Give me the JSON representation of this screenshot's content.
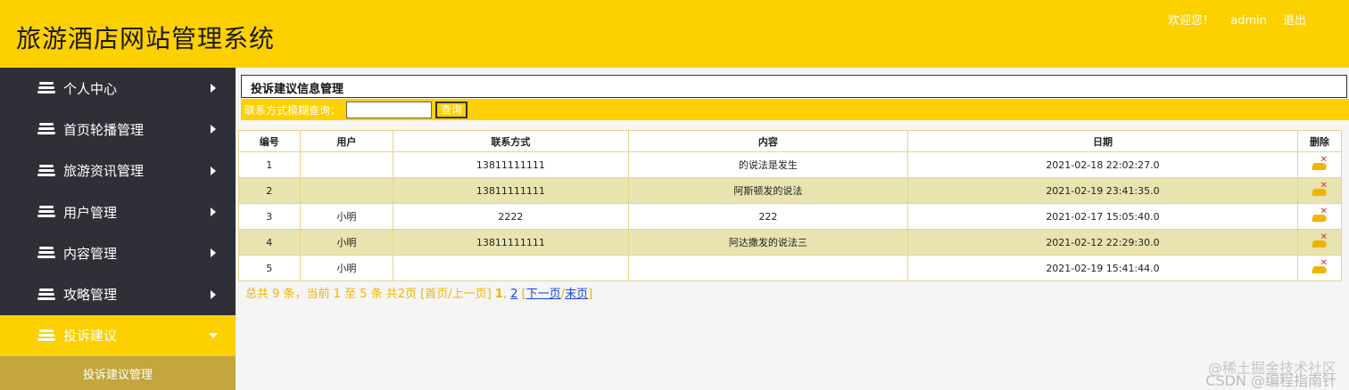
{
  "app": {
    "title": "旅游酒店网站管理系统"
  },
  "top_links": {
    "welcome": "欢迎您！",
    "user": "admin",
    "logout": "退出"
  },
  "sidebar": {
    "items": [
      {
        "label": "个人中心"
      },
      {
        "label": "首页轮播管理"
      },
      {
        "label": "旅游资讯管理"
      },
      {
        "label": "用户管理"
      },
      {
        "label": "内容管理"
      },
      {
        "label": "攻略管理"
      },
      {
        "label": "投诉建议"
      }
    ],
    "sub_item": "投诉建议管理"
  },
  "main": {
    "section_title": "投诉建议信息管理",
    "search_label": "联系方式模糊查询：",
    "search_value": "",
    "search_button": "查询",
    "columns": [
      "编号",
      "用户",
      "联系方式",
      "内容",
      "日期",
      "删除"
    ],
    "rows": [
      {
        "id": "1",
        "user": "",
        "contact": "13811111111",
        "content": "的说法是发生",
        "date": "2021-02-18 22:02:27.0"
      },
      {
        "id": "2",
        "user": "",
        "contact": "13811111111",
        "content": "阿斯顿发的说法",
        "date": "2021-02-19 23:41:35.0"
      },
      {
        "id": "3",
        "user": "小明",
        "contact": "2222",
        "content": "222",
        "date": "2021-02-17 15:05:40.0"
      },
      {
        "id": "4",
        "user": "小明",
        "contact": "13811111111",
        "content": "阿达撒发的说法三",
        "date": "2021-02-12 22:29:30.0"
      },
      {
        "id": "5",
        "user": "小明",
        "contact": "",
        "content": "",
        "date": "2021-02-19 15:41:44.0"
      }
    ],
    "pager": {
      "summary": "总共 9 条，当前 1 至 5 条 共2页",
      "first_prev": "[首页/上一页]",
      "page1": "1",
      "comma": ",",
      "page2": "2",
      "bracket_open": "[",
      "next": "下一页",
      "slash": "/",
      "last": "末页",
      "bracket_close": "]"
    }
  },
  "watermark": {
    "line1": "@稀土掘金技术社区",
    "line2": "CSDN @编程指南针"
  },
  "colors": {
    "accent": "#fdd000",
    "sidebar": "#2f3037",
    "sub_item": "#c3a63e",
    "row_alt": "#e8e4b0"
  }
}
